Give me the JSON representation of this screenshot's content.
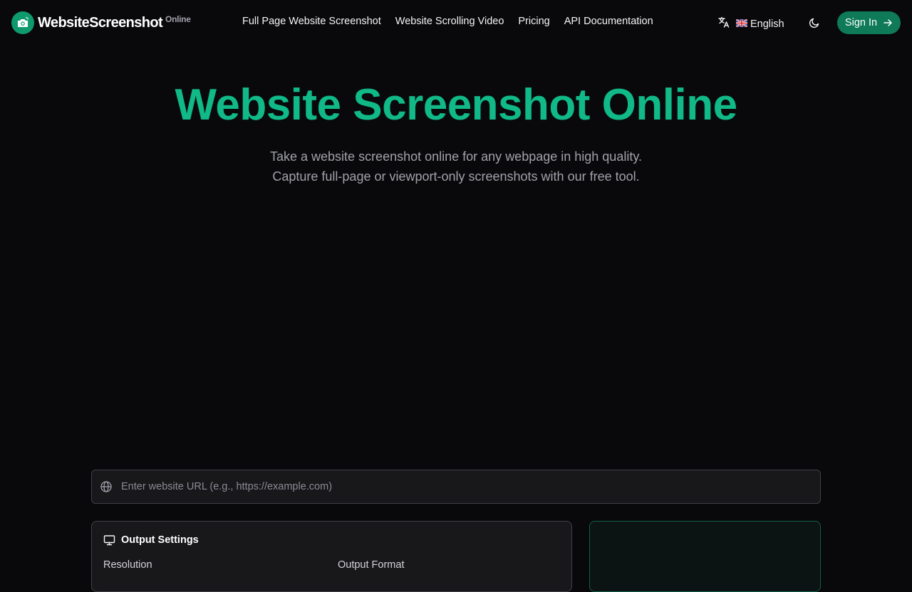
{
  "header": {
    "logo_text": "WebsiteScreenshot",
    "logo_sup": "Online",
    "nav": [
      {
        "label": "Full Page Website Screenshot"
      },
      {
        "label": "Website Scrolling Video"
      },
      {
        "label": "Pricing"
      },
      {
        "label": "API Documentation"
      }
    ],
    "language_label": "English",
    "signin_label": "Sign In"
  },
  "hero": {
    "title": "Website Screenshot Online",
    "subtitle_line1": "Take a website screenshot online for any webpage in high quality.",
    "subtitle_line2": "Capture full-page or viewport-only screenshots with our free tool."
  },
  "url_input": {
    "placeholder": "Enter website URL (e.g., https://example.com)",
    "value": ""
  },
  "settings": {
    "title": "Output Settings",
    "resolution_label": "Resolution",
    "format_label": "Output Format"
  },
  "colors": {
    "accent": "#10b987",
    "button": "#0f7a58",
    "background": "#09090b"
  }
}
